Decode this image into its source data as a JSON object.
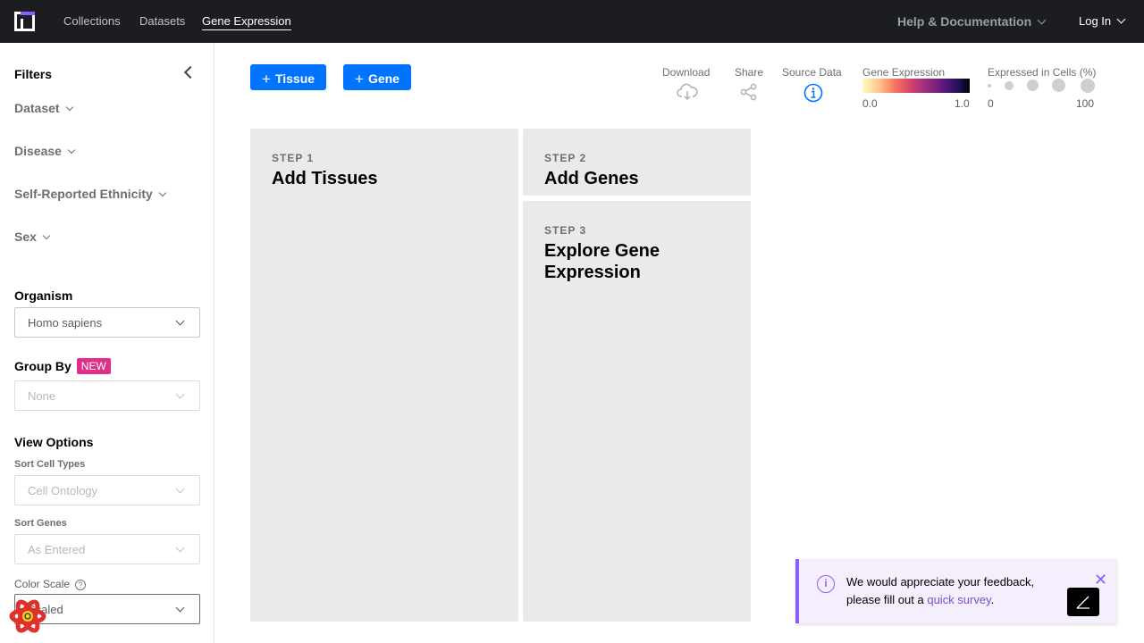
{
  "nav": {
    "links": [
      "Collections",
      "Datasets",
      "Gene Expression"
    ],
    "help": "Help & Documentation",
    "login": "Log In"
  },
  "sidebar": {
    "title": "Filters",
    "filters": [
      "Dataset",
      "Disease",
      "Self-Reported Ethnicity",
      "Sex"
    ],
    "organism": {
      "label": "Organism",
      "value": "Homo sapiens"
    },
    "group_by": {
      "label": "Group By",
      "badge": "NEW",
      "value": "None"
    },
    "view_options": {
      "label": "View Options",
      "sort_cell_types": {
        "label": "Sort Cell Types",
        "value": "Cell Ontology"
      },
      "sort_genes": {
        "label": "Sort Genes",
        "value": "As Entered"
      },
      "color_scale": {
        "label": "Color Scale",
        "help": "?",
        "value": "Scaled"
      }
    }
  },
  "toolbar": {
    "add_tissue": "Tissue",
    "add_gene": "Gene",
    "download": "Download",
    "share": "Share",
    "source_data": "Source Data",
    "gene_expression": {
      "label": "Gene Expression",
      "min": "0.0",
      "max": "1.0"
    },
    "expressed_in_cells": {
      "label": "Expressed in Cells (%)",
      "min": "0",
      "max": "100"
    }
  },
  "steps": [
    {
      "num": "STEP 1",
      "title": "Add Tissues"
    },
    {
      "num": "STEP 2",
      "title": "Add Genes"
    },
    {
      "num": "STEP 3",
      "title": "Explore Gene Expression"
    }
  ],
  "toast": {
    "text": "We would appreciate your feedback, please fill out a ",
    "link": "quick survey",
    "suffix": "."
  },
  "colors": {
    "nav_bg": "#1b1d21",
    "primary": "#0073ff",
    "accent": "#8f5cff",
    "badge": "#e02f8b",
    "panel": "#eaeaea"
  }
}
